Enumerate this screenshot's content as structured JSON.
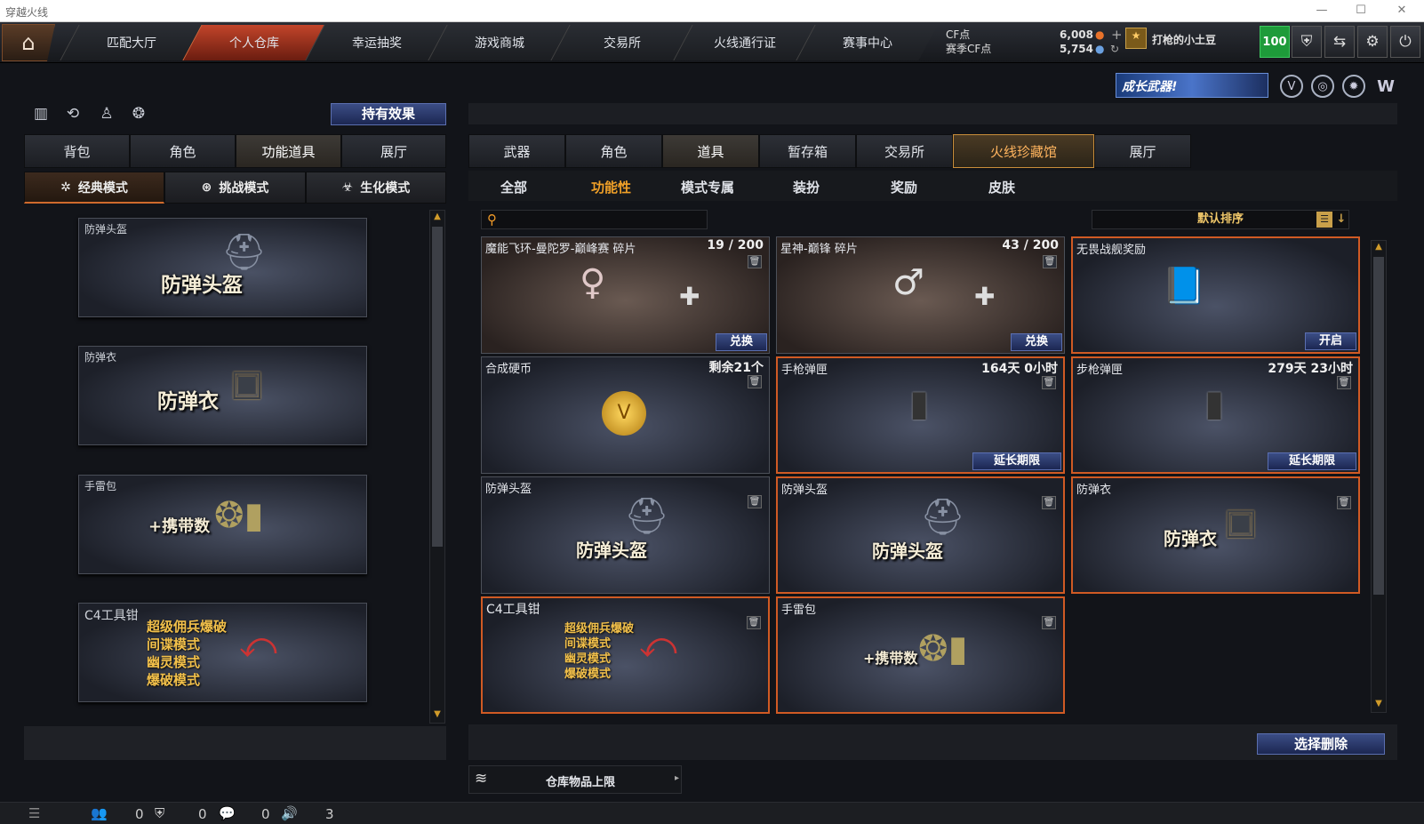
{
  "window": {
    "title": "穿越火线",
    "min": "—",
    "max": "☐",
    "close": "✕"
  },
  "nav": {
    "home_icon": "home-icon",
    "tabs": [
      {
        "label": "匹配大厅"
      },
      {
        "label": "个人仓库"
      },
      {
        "label": "幸运抽奖"
      },
      {
        "label": "游戏商城"
      },
      {
        "label": "交易所"
      },
      {
        "label": "火线通行证"
      },
      {
        "label": "赛事中心"
      }
    ]
  },
  "currency": {
    "cf_label": "CF点",
    "cf_value": "6,008",
    "season_label": "赛季CF点",
    "season_value": "5,754",
    "plus": "+"
  },
  "user": {
    "name": "打枪的小土豆",
    "level": "100"
  },
  "banner": {
    "text": "成长武器!"
  },
  "left": {
    "effects_button": "持有效果",
    "tabs": [
      "背包",
      "角色",
      "功能道具",
      "展厅"
    ],
    "modes": [
      "经典模式",
      "挑战模式",
      "生化模式"
    ],
    "cards": [
      {
        "label": "防弹头盔",
        "big": "防弹头盔"
      },
      {
        "label": "防弹衣",
        "big": "防弹衣"
      },
      {
        "label": "手雷包",
        "big": "+携带数"
      },
      {
        "label": "C4工具钳",
        "lines": [
          "超级佣兵爆破",
          "间谍模式",
          "幽灵模式",
          "爆破模式"
        ]
      }
    ]
  },
  "right": {
    "tabs": [
      "武器",
      "角色",
      "道具",
      "暂存箱",
      "交易所",
      "火线珍藏馆",
      "展厅"
    ],
    "subtabs": [
      "全部",
      "功能性",
      "模式专属",
      "装扮",
      "奖励",
      "皮肤"
    ],
    "search_placeholder": "",
    "sort_label": "默认排序",
    "items": [
      {
        "title": "魔能飞环-曼陀罗-巅峰赛 碎片",
        "meta": "19 / 200",
        "action": "兑换"
      },
      {
        "title": "星神-巅锋 碎片",
        "meta": "43 / 200",
        "action": "兑换"
      },
      {
        "title": "无畏战舰奖励",
        "meta": "",
        "action": "开启"
      },
      {
        "title": "合成硬币",
        "meta": "剩余21个",
        "action": ""
      },
      {
        "title": "手枪弹匣",
        "meta": "164天 0小时",
        "action": "延长期限"
      },
      {
        "title": "步枪弹匣",
        "meta": "279天 23小时",
        "action": "延长期限"
      },
      {
        "title": "防弹头盔",
        "meta": "",
        "big": "防弹头盔"
      },
      {
        "title": "防弹头盔",
        "meta": "",
        "big": "防弹头盔"
      },
      {
        "title": "防弹衣",
        "meta": "",
        "big": "防弹衣"
      },
      {
        "title": "C4工具钳",
        "meta": "",
        "lines": [
          "超级佣兵爆破",
          "间谍模式",
          "幽灵模式",
          "爆破模式"
        ]
      },
      {
        "title": "手雷包",
        "meta": "",
        "big": "+携带数"
      }
    ],
    "select_delete": "选择删除",
    "capacity_label": "仓库物品上限"
  },
  "status": {
    "v1": "0",
    "v2": "0",
    "v3": "0",
    "v4": "3"
  }
}
